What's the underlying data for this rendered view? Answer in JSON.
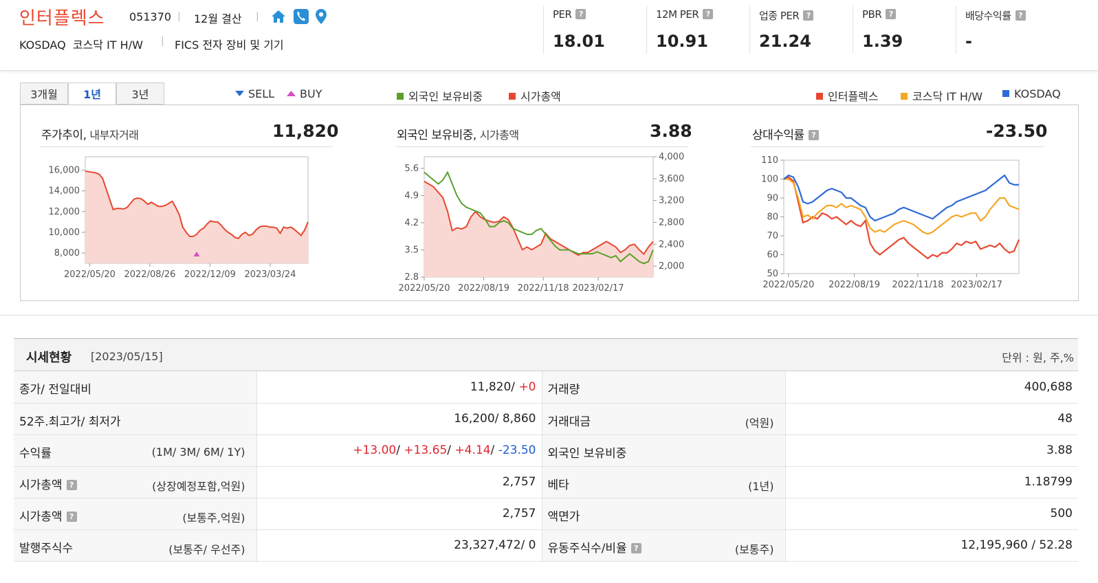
{
  "header": {
    "company_name": "인터플렉스",
    "stock_code": "051370",
    "fiscal": "12월 결산",
    "market": "KOSDAQ  코스닥 IT H/W",
    "fics": "FICS 전자 장비 및 기기",
    "icons": [
      "home-icon",
      "phone-icon",
      "location-pin-icon"
    ],
    "metrics": [
      {
        "label": "PER",
        "value": "18.01"
      },
      {
        "label": "12M PER",
        "value": "10.91"
      },
      {
        "label": "업종 PER",
        "value": "21.24"
      },
      {
        "label": "PBR",
        "value": "1.39"
      },
      {
        "label": "배당수익률",
        "value": "-"
      }
    ],
    "help_mark": "?"
  },
  "chart_panel": {
    "tabs": [
      "3개월",
      "1년",
      "3년"
    ],
    "active_tab": "1년",
    "legend_trade": {
      "sell": "SELL",
      "buy": "BUY"
    },
    "legend_foreign": {
      "a": "외국인 보유비중",
      "b": "시가총액"
    },
    "legend_relative": {
      "a": "인터플렉스",
      "b": "코스닥 IT H/W",
      "c": "KOSDAQ"
    },
    "colors": {
      "price": "#e8472f",
      "foreign": "#5aa02c",
      "kosdaq_it": "#f5a623",
      "kosdaq": "#2d6ad6",
      "fill": "#f9d8d3"
    }
  },
  "chart_data": [
    {
      "type": "area",
      "title": "주가추이",
      "subtitle": "내부자거래",
      "headline": "11,820",
      "x_ticks": [
        "2022/05/20",
        "2022/08/26",
        "2022/12/09",
        "2023/03/24"
      ],
      "y_ticks": [
        "16,000",
        "14,000",
        "12,000",
        "10,000",
        "8,000"
      ],
      "ylim": [
        7000,
        17300
      ],
      "series": [
        {
          "values": [
            15900,
            15850,
            15800,
            15750,
            15600,
            15200,
            14200,
            13200,
            12200,
            12300,
            12300,
            12250,
            12400,
            12800,
            13200,
            13300,
            13250,
            13000,
            12700,
            12900,
            12700,
            12500,
            12500,
            12600,
            12800,
            13000,
            12400,
            11700,
            10500,
            10000,
            9600,
            9600,
            9800,
            10200,
            10400,
            10800,
            11100,
            11000,
            11000,
            10700,
            10300,
            10000,
            9800,
            9500,
            9400,
            9800,
            10000,
            9700,
            9800,
            10200,
            10500,
            10600,
            10600,
            10500,
            10500,
            10400,
            9900,
            10500,
            10400,
            10500,
            10300,
            10000,
            9700,
            10200,
            11000
          ]
        }
      ],
      "markers": [
        {
          "type": "BUY",
          "index": 32
        }
      ]
    },
    {
      "type": "line",
      "title": "외국인 보유비중",
      "subtitle": "시가총액",
      "headline": "3.88",
      "x_ticks": [
        "2022/05/20",
        "2022/08/19",
        "2022/11/18",
        "2023/02/17"
      ],
      "y_left_ticks": [
        "5.6",
        "4.9",
        "4.2",
        "3.5",
        "2.8"
      ],
      "y_right_ticks": [
        "4,000",
        "3,600",
        "3,200",
        "2,800",
        "2,400",
        "2,000"
      ],
      "ylim_left": [
        2.8,
        5.9
      ],
      "ylim_right": [
        1800,
        4000
      ],
      "series": [
        {
          "name": "외국인 보유비중",
          "values": [
            5.5,
            5.4,
            5.3,
            5.2,
            5.3,
            5.5,
            5.2,
            4.9,
            4.7,
            4.6,
            4.55,
            4.5,
            4.45,
            4.3,
            4.1,
            4.1,
            4.2,
            4.25,
            4.2,
            4.05,
            4.0,
            3.95,
            3.9,
            3.9,
            4.0,
            4.05,
            3.9,
            3.75,
            3.6,
            3.5,
            3.5,
            3.5,
            3.45,
            3.4,
            3.4,
            3.4,
            3.4,
            3.45,
            3.4,
            3.35,
            3.3,
            3.35,
            3.2,
            3.3,
            3.4,
            3.3,
            3.2,
            3.15,
            3.2,
            3.5
          ]
        },
        {
          "name": "시가총액",
          "values": [
            3550,
            3500,
            3450,
            3350,
            3250,
            3000,
            2650,
            2700,
            2680,
            2720,
            2900,
            3000,
            2900,
            2850,
            2820,
            2800,
            2820,
            2900,
            2850,
            2700,
            2500,
            2300,
            2350,
            2300,
            2350,
            2400,
            2600,
            2500,
            2450,
            2400,
            2350,
            2300,
            2250,
            2200,
            2250,
            2250,
            2300,
            2350,
            2400,
            2450,
            2400,
            2350,
            2250,
            2300,
            2380,
            2400,
            2300,
            2220,
            2350,
            2450
          ]
        }
      ]
    },
    {
      "type": "line",
      "title": "상대수익률",
      "headline": "-23.50",
      "x_ticks": [
        "2022/05/20",
        "2022/08/19",
        "2022/11/18",
        "2023/02/17"
      ],
      "y_ticks": [
        "110",
        "100",
        "90",
        "80",
        "70",
        "60",
        "50"
      ],
      "ylim": [
        50,
        110
      ],
      "series": [
        {
          "name": "인터플렉스",
          "values": [
            100,
            101,
            99,
            88,
            77,
            78,
            80,
            79,
            82,
            81,
            79,
            80,
            78,
            76,
            78,
            76,
            75,
            78,
            66,
            62,
            60,
            62,
            64,
            66,
            68,
            69,
            66,
            64,
            62,
            60,
            58,
            60,
            59,
            61,
            61,
            63,
            66,
            65,
            67,
            66,
            67,
            63,
            64,
            65,
            64,
            66,
            63,
            61,
            62,
            68
          ]
        },
        {
          "name": "코스닥 IT H/W",
          "values": [
            100,
            100,
            98,
            90,
            80,
            81,
            79,
            82,
            84,
            86,
            86,
            85,
            87,
            85,
            86,
            85,
            84,
            80,
            74,
            72,
            73,
            72,
            74,
            76,
            77,
            78,
            77,
            76,
            74,
            72,
            71,
            72,
            74,
            76,
            78,
            80,
            81,
            80,
            81,
            82,
            82,
            78,
            80,
            84,
            87,
            90,
            90,
            86,
            85,
            84
          ]
        },
        {
          "name": "KOSDAQ",
          "values": [
            100,
            102,
            101,
            96,
            88,
            87,
            88,
            90,
            92,
            94,
            95,
            94,
            93,
            90,
            90,
            88,
            86,
            85,
            80,
            78,
            79,
            80,
            81,
            82,
            84,
            85,
            84,
            83,
            82,
            81,
            80,
            79,
            81,
            83,
            85,
            86,
            88,
            89,
            90,
            91,
            92,
            93,
            94,
            96,
            98,
            100,
            102,
            98,
            97,
            97
          ]
        }
      ]
    }
  ],
  "quote": {
    "title": "시세현황",
    "date": "[2023/05/15]",
    "unit": "단위 : 원, 주,%",
    "rows": [
      {
        "l_label": "종가/ 전일대비",
        "l_sub": "",
        "l_v1": "11,820",
        "l_sep": "/ ",
        "l_v2": "+0",
        "r_label": "거래량",
        "r_sub": "",
        "r_value": "400,688"
      },
      {
        "l_label": "52주.최고가/ 최저가",
        "l_sub": "",
        "l_value": "16,200/ 8,860",
        "r_label": "거래대금",
        "r_sub": "(억원)",
        "r_value": "48"
      },
      {
        "l_label": "수익률",
        "l_sub": "(1M/ 3M/ 6M/ 1Y)",
        "ret": [
          "+13.00",
          "+13.65",
          "+4.14",
          "-23.50"
        ],
        "sep": "/ ",
        "r_label": "외국인 보유비중",
        "r_sub": "",
        "r_value": "3.88"
      },
      {
        "l_label": "시가총액",
        "l_sub": "(상장예정포함,억원)",
        "l_value": "2,757",
        "r_label": "베타",
        "r_sub": "(1년)",
        "r_value": "1.18799"
      },
      {
        "l_label": "시가총액",
        "l_sub": "(보통주,억원)",
        "l_value": "2,757",
        "r_label": "액면가",
        "r_sub": "",
        "r_value": "500"
      },
      {
        "l_label": "발행주식수",
        "l_sub": "(보통주/ 우선주)",
        "l_value": "23,327,472/ 0",
        "r_label": "유동주식수/비율",
        "r_sub": "(보통주)",
        "r_value": "12,195,960 / 52.28"
      }
    ]
  }
}
